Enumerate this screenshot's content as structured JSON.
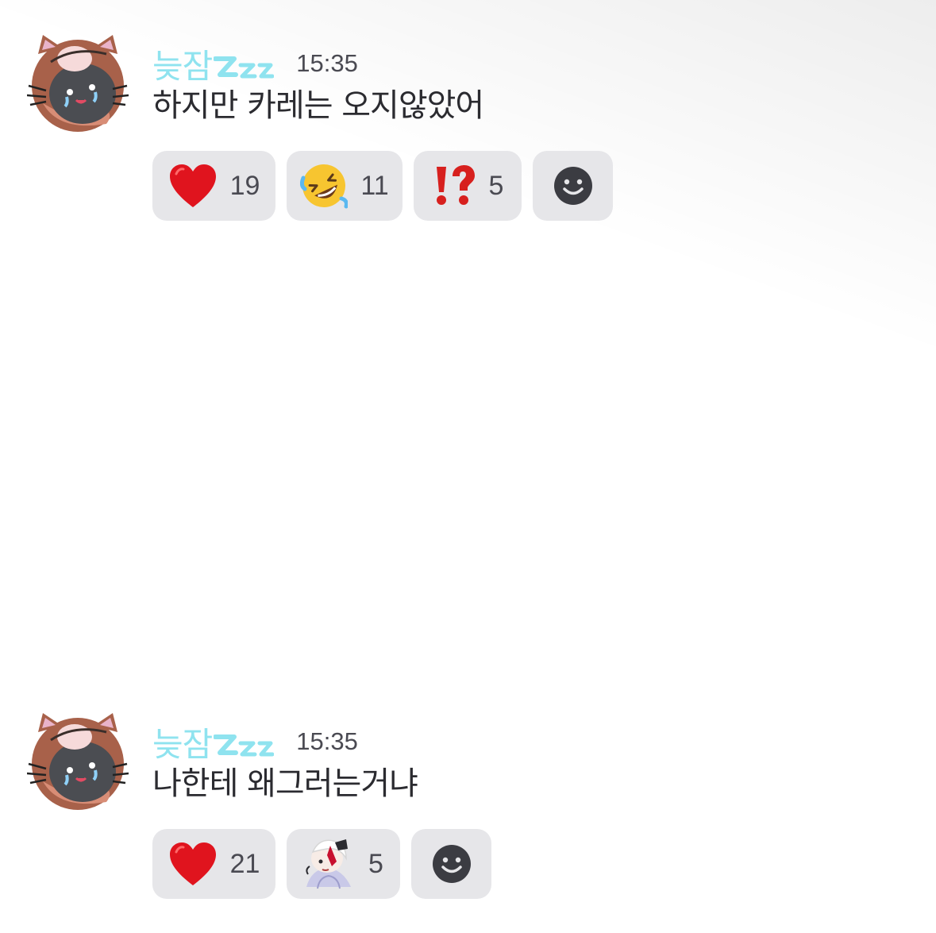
{
  "messages": [
    {
      "username": "늦잠",
      "username_suffix_icon": "zzz-icon",
      "time": "15:35",
      "text": "하지만 카레는 오지않았어",
      "reactions": [
        {
          "icon": "red-heart-icon",
          "count": "19"
        },
        {
          "icon": "rolling-laughing-face-icon",
          "count": "11"
        },
        {
          "icon": "exclamation-question-icon",
          "count": "5"
        }
      ],
      "add_reaction_icon": "smiley-add-reaction-icon"
    },
    {
      "username": "늦잠",
      "username_suffix_icon": "zzz-icon",
      "time": "15:35",
      "text": "나한테 왜그러는거냐",
      "reactions": [
        {
          "icon": "red-heart-icon",
          "count": "21"
        },
        {
          "icon": "custom-anime-sticker-icon",
          "count": "5"
        }
      ],
      "add_reaction_icon": "smiley-add-reaction-icon"
    }
  ],
  "colors": {
    "username": "#8fe3ef",
    "chip_bg": "#e6e6e9",
    "text": "#2b2b30",
    "muted": "#4a4a52"
  }
}
